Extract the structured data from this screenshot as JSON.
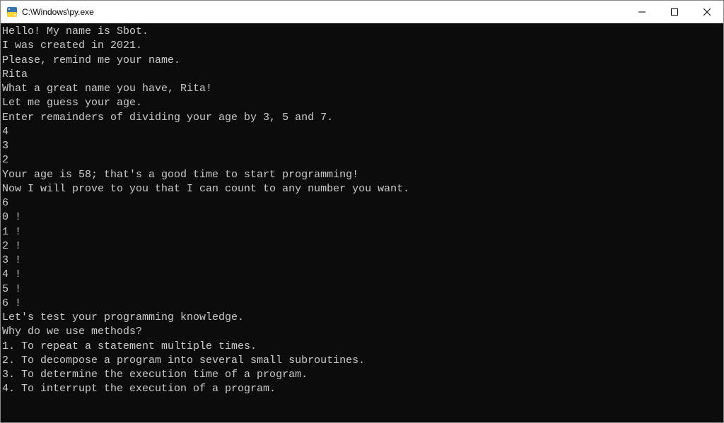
{
  "window": {
    "title": "C:\\Windows\\py.exe"
  },
  "console": {
    "lines": [
      "Hello! My name is Sbot.",
      "I was created in 2021.",
      "Please, remind me your name.",
      "Rita",
      "What a great name you have, Rita!",
      "Let me guess your age.",
      "Enter remainders of dividing your age by 3, 5 and 7.",
      "4",
      "3",
      "2",
      "Your age is 58; that's a good time to start programming!",
      "Now I will prove to you that I can count to any number you want.",
      "6",
      "0 !",
      "1 !",
      "2 !",
      "3 !",
      "4 !",
      "5 !",
      "6 !",
      "Let's test your programming knowledge.",
      "Why do we use methods?",
      "1. To repeat a statement multiple times.",
      "2. To decompose a program into several small subroutines.",
      "3. To determine the execution time of a program.",
      "4. To interrupt the execution of a program."
    ]
  }
}
